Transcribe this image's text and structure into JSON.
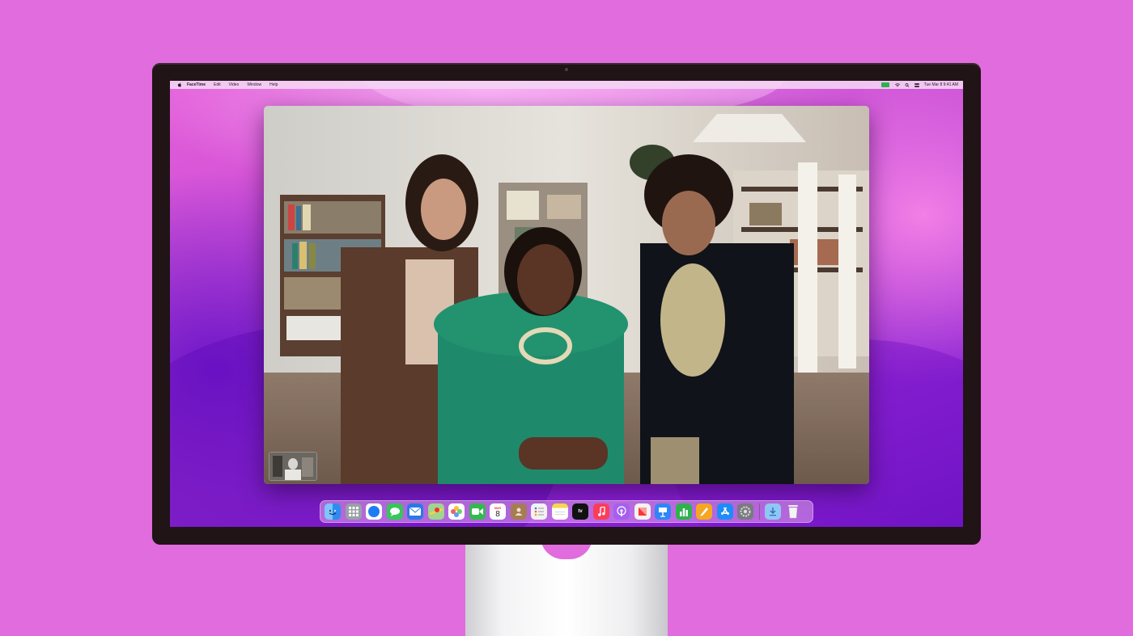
{
  "menubar": {
    "app_name": "FaceTime",
    "items": [
      "Edit",
      "Video",
      "Window",
      "Help"
    ],
    "clock": "Tue Mar 8  9:41 AM"
  },
  "calendar": {
    "month": "MAR",
    "day": "8"
  },
  "dock": {
    "apps": [
      {
        "name": "Finder",
        "color": "#2d8cf0"
      },
      {
        "name": "Launchpad",
        "color": "#9aa0a8"
      },
      {
        "name": "Safari",
        "color": "#1e7cf2"
      },
      {
        "name": "Messages",
        "color": "#35c759"
      },
      {
        "name": "Mail",
        "color": "#2a79e8"
      },
      {
        "name": "Maps",
        "color": "#5cbd63"
      },
      {
        "name": "Photos",
        "color": "#f0c040"
      },
      {
        "name": "FaceTime",
        "color": "#34b94f"
      },
      {
        "name": "Calendar",
        "color": "#ffffff"
      },
      {
        "name": "Contacts",
        "color": "#a67c52"
      },
      {
        "name": "Reminders",
        "color": "#f2f2f2"
      },
      {
        "name": "Notes",
        "color": "#f7d64a"
      },
      {
        "name": "TV",
        "color": "#111111"
      },
      {
        "name": "Music",
        "color": "#fb3c5a"
      },
      {
        "name": "Podcasts",
        "color": "#a55ff0"
      },
      {
        "name": "News",
        "color": "#f2f2f2"
      },
      {
        "name": "Keynote",
        "color": "#2f86f6"
      },
      {
        "name": "Numbers",
        "color": "#2eb24d"
      },
      {
        "name": "Pages",
        "color": "#f5a623"
      },
      {
        "name": "App Store",
        "color": "#1d8cf8"
      },
      {
        "name": "System Preferences",
        "color": "#7a7a80"
      }
    ],
    "tv_label": "tv"
  },
  "colors": {
    "background": "#e06cdd",
    "facetime_green": "#2bb14d"
  }
}
